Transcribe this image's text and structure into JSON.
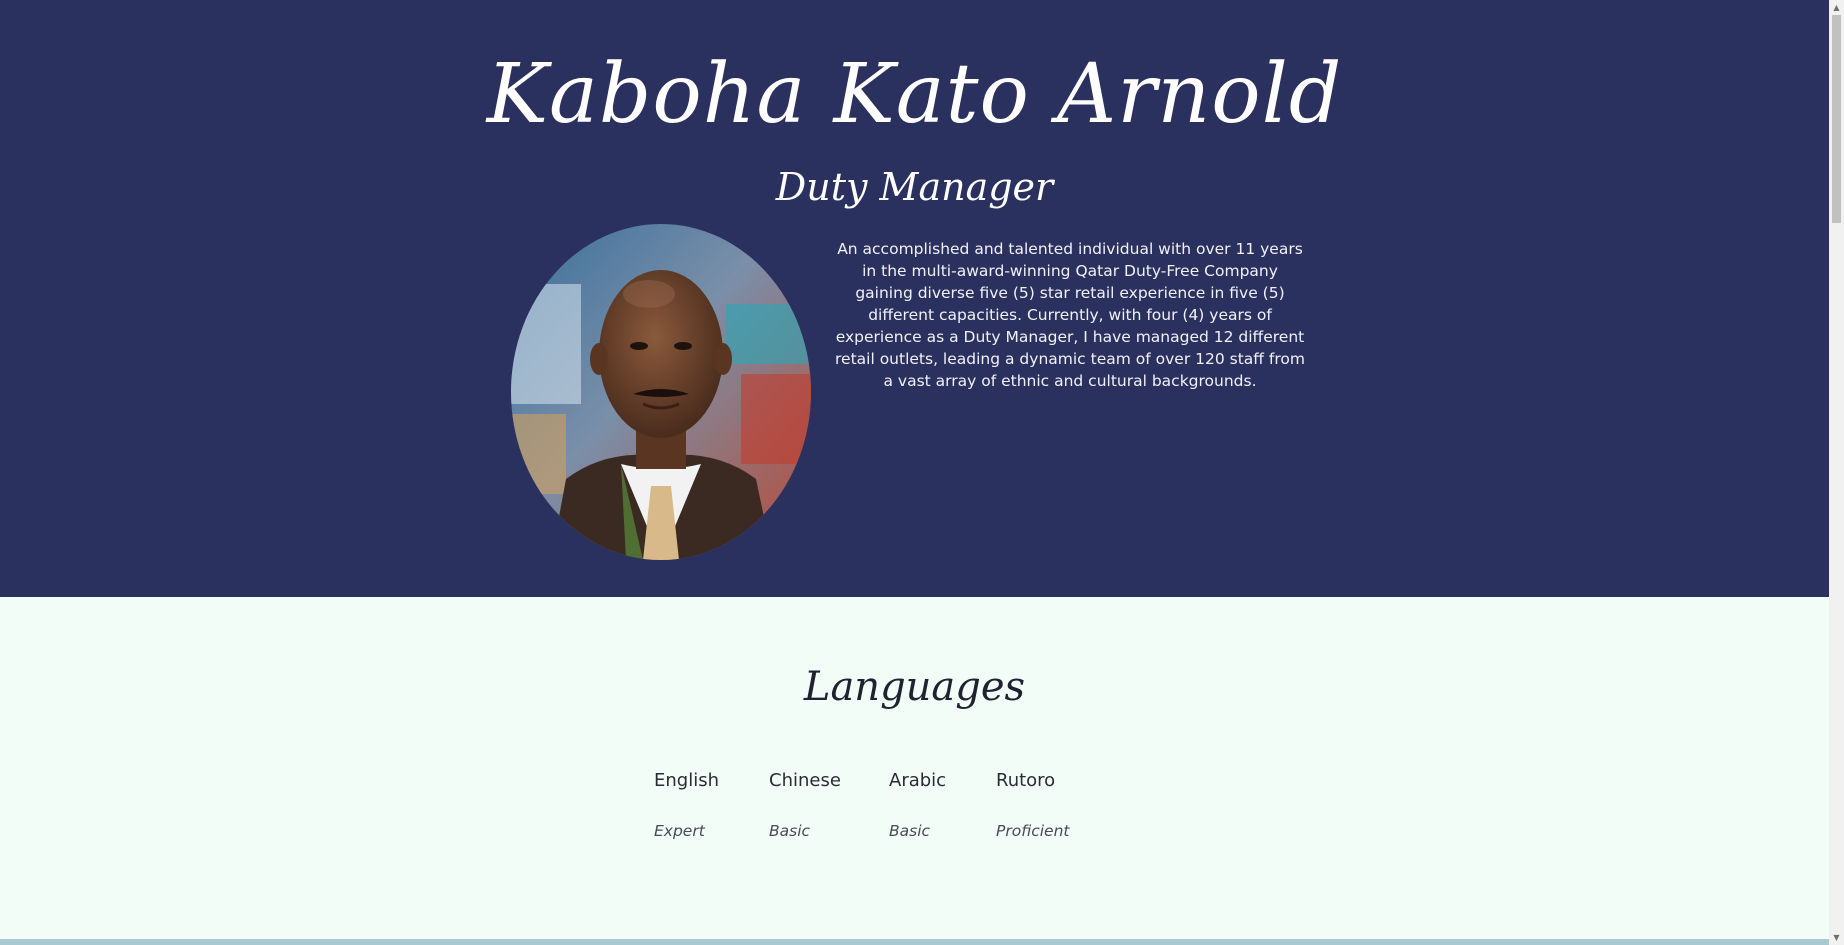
{
  "hero": {
    "name": "Kaboha Kato Arnold",
    "role": "Duty Manager",
    "bio": "An accomplished and talented individual with over 11 years in the multi-award-winning Qatar Duty-Free Company gaining diverse five (5) star retail experience in five (5) different capacities. Currently, with four (4) years of experience as a Duty Manager, I have managed 12 different retail outlets, leading a dynamic team of over 120 staff from a vast array of ethnic and cultural backgrounds.",
    "background_color": "#2b315f"
  },
  "languages": {
    "title": "Languages",
    "items": [
      {
        "name": "English",
        "level": "Expert"
      },
      {
        "name": "Chinese",
        "level": "Basic"
      },
      {
        "name": "Arabic",
        "level": "Basic"
      },
      {
        "name": "Rutoro",
        "level": "Proficient"
      }
    ]
  },
  "icons": {
    "scroll_up": "scroll-up-arrow-icon",
    "scroll_down": "scroll-down-arrow-icon"
  }
}
